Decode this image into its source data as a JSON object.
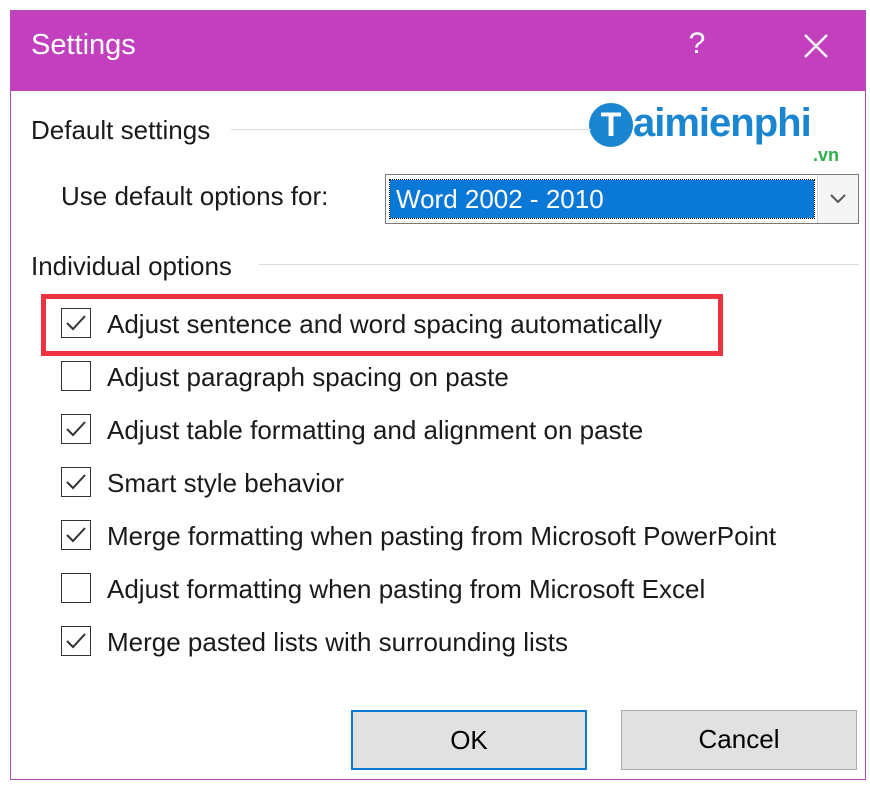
{
  "window": {
    "title": "Settings",
    "help_label": "?",
    "close_icon": "close-icon"
  },
  "watermark": {
    "initial": "T",
    "text": "aimienphi",
    "domain": ".vn"
  },
  "default_settings": {
    "group_label": "Default settings",
    "select_label": "Use default options for:",
    "select_value": "Word 2002 - 2010"
  },
  "individual_options": {
    "group_label": "Individual options",
    "items": [
      {
        "label": "Adjust sentence and word spacing automatically",
        "checked": true,
        "highlighted": true
      },
      {
        "label": "Adjust paragraph spacing on paste",
        "checked": false,
        "highlighted": false
      },
      {
        "label": "Adjust table formatting and alignment on paste",
        "checked": true,
        "highlighted": false
      },
      {
        "label": "Smart style behavior",
        "checked": true,
        "highlighted": false
      },
      {
        "label": "Merge formatting when pasting from Microsoft PowerPoint",
        "checked": true,
        "highlighted": false
      },
      {
        "label": "Adjust formatting when pasting from Microsoft Excel",
        "checked": false,
        "highlighted": false
      },
      {
        "label": "Merge pasted lists with surrounding lists",
        "checked": true,
        "highlighted": false
      }
    ]
  },
  "buttons": {
    "ok": "OK",
    "cancel": "Cancel"
  },
  "colors": {
    "titlebar": "#c23fbe",
    "highlight": "#ee3340",
    "selection": "#0a78d7"
  }
}
